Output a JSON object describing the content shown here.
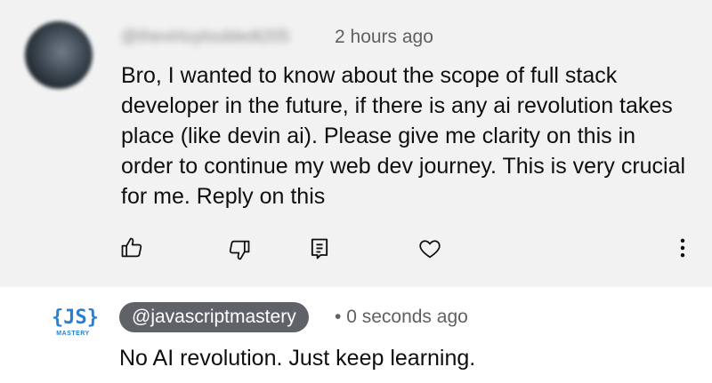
{
  "comment": {
    "author": "@thevirtuyloubledt205",
    "timestamp": "2 hours ago",
    "text": "Bro, I wanted to know about the scope of full stack developer in the future, if there is any ai revolution takes place (like devin ai). Please give me clarity on this in order to continue my web dev journey. This is very crucial for me. Reply on this",
    "actions": [
      "thumbs-up-icon",
      "thumbs-down-icon",
      "reply-icon",
      "heart-icon",
      "more-vert-icon"
    ]
  },
  "reply": {
    "logo": {
      "mark": "{JS}",
      "sub": "MASTERY"
    },
    "handle": "@javascriptmastery",
    "separator": "•",
    "timestamp": "0 seconds ago",
    "text": "No AI revolution. Just keep learning."
  },
  "colors": {
    "comment_background": "#f2f2f2",
    "reply_background": "#ffffff",
    "handle_pill": "#5f6368",
    "logo_blue": "#2a7fd0"
  }
}
